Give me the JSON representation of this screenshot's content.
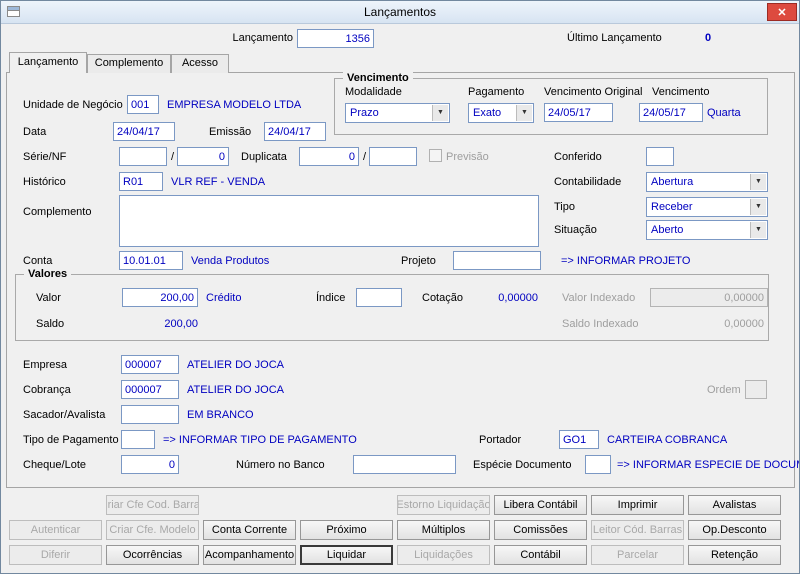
{
  "window": {
    "title": "Lançamentos",
    "close_glyph": "✕"
  },
  "header": {
    "lancamento_label": "Lançamento",
    "lancamento_value": "1356",
    "ultimo_label": "Último Lançamento",
    "ultimo_value": "0"
  },
  "tabs": {
    "t1": "Lançamento",
    "t2": "Complemento",
    "t3": "Acesso"
  },
  "main": {
    "unidade": {
      "label": "Unidade de Negócio",
      "value": "001",
      "desc": "EMPRESA MODELO LTDA"
    },
    "data": {
      "label": "Data",
      "value": "24/04/17"
    },
    "emissao": {
      "label": "Emissão",
      "value": "24/04/17"
    },
    "serie": {
      "label": "Série/NF",
      "v1": "",
      "sep": "/",
      "v2": "0"
    },
    "duplicata": {
      "label": "Duplicata",
      "v1": "0",
      "sep": "/",
      "v2": ""
    },
    "previsao": {
      "label": "Previsão"
    },
    "conferido": {
      "label": "Conferido",
      "value": ""
    },
    "historico": {
      "label": "Histórico",
      "value": "R01",
      "desc": "VLR REF - VENDA"
    },
    "contabilidade": {
      "label": "Contabilidade",
      "value": "Abertura"
    },
    "complemento": {
      "label": "Complemento",
      "value": ""
    },
    "tipo": {
      "label": "Tipo",
      "value": "Receber"
    },
    "situacao": {
      "label": "Situação",
      "value": "Aberto"
    },
    "conta": {
      "label": "Conta",
      "value": "10.01.01",
      "desc": "Venda Produtos"
    },
    "projeto": {
      "label": "Projeto",
      "value": "",
      "desc": "=> INFORMAR PROJETO"
    },
    "empresa": {
      "label": "Empresa",
      "value": "000007",
      "desc": "ATELIER DO JOCA"
    },
    "cobranca": {
      "label": "Cobrança",
      "value": "000007",
      "desc": "ATELIER DO JOCA"
    },
    "ordem": {
      "label": "Ordem",
      "value": ""
    },
    "sacador": {
      "label": "Sacador/Avalista",
      "value": "",
      "desc": "EM BRANCO"
    },
    "tipo_pagamento": {
      "label": "Tipo de Pagamento",
      "value": "",
      "desc": "=> INFORMAR TIPO DE PAGAMENTO"
    },
    "portador": {
      "label": "Portador",
      "value": "GO1",
      "desc": "CARTEIRA COBRANCA"
    },
    "cheque_lote": {
      "label": "Cheque/Lote",
      "value": "0"
    },
    "numero_banco": {
      "label": "Número no Banco",
      "value": ""
    },
    "especie": {
      "label": "Espécie Documento",
      "value": "",
      "desc": "=> INFORMAR ESPECIE DE DOCUM"
    }
  },
  "vencimento": {
    "title": "Vencimento",
    "modalidade_label": "Modalidade",
    "modalidade_value": "Prazo",
    "pagamento_label": "Pagamento",
    "pagamento_value": "Exato",
    "original_label": "Vencimento Original",
    "original_value": "24/05/17",
    "vencimento_label": "Vencimento",
    "vencimento_value": "24/05/17",
    "weekday": "Quarta"
  },
  "valores": {
    "title": "Valores",
    "valor_label": "Valor",
    "valor_value": "200,00",
    "valor_desc": "Crédito",
    "indice_label": "Índice",
    "indice_value": "",
    "cotacao_label": "Cotação",
    "cotacao_value": "0,00000",
    "valor_indexado_label": "Valor Indexado",
    "valor_indexado_value": "0,00000",
    "saldo_label": "Saldo",
    "saldo_value": "200,00",
    "saldo_indexado_label": "Saldo Indexado",
    "saldo_indexado_value": "0,00000"
  },
  "buttons": {
    "row1": [
      {
        "label": "Criar Cfe Cod. Barras",
        "enabled": false
      },
      {
        "label": "Estorno Liquidação",
        "enabled": false
      },
      {
        "label": "Libera Contábil",
        "enabled": true
      },
      {
        "label": "Imprimir",
        "enabled": true
      },
      {
        "label": "Avalistas",
        "enabled": true
      }
    ],
    "row2": [
      {
        "label": "Autenticar",
        "enabled": false
      },
      {
        "label": "Criar Cfe. Modelo",
        "enabled": false
      },
      {
        "label": "Conta Corrente",
        "enabled": true
      },
      {
        "label": "Próximo",
        "enabled": true
      },
      {
        "label": "Múltiplos",
        "enabled": true
      },
      {
        "label": "Comissões",
        "enabled": true
      },
      {
        "label": "Leitor Cód. Barras",
        "enabled": false
      },
      {
        "label": "Op.Desconto",
        "enabled": true
      }
    ],
    "row3": [
      {
        "label": "Diferir",
        "enabled": false
      },
      {
        "label": "Ocorrências",
        "enabled": true
      },
      {
        "label": "Acompanhamento",
        "enabled": true
      },
      {
        "label": "Liquidar",
        "enabled": true,
        "focused": true
      },
      {
        "label": "Liquidações",
        "enabled": false
      },
      {
        "label": "Contábil",
        "enabled": true
      },
      {
        "label": "Parcelar",
        "enabled": false
      },
      {
        "label": "Retenção",
        "enabled": true
      }
    ]
  },
  "colors": {
    "value_text": "#0000c0",
    "disabled_text": "#9e9e9e",
    "input_border": "#7b98c4",
    "close_button": "#dd4a3f",
    "titlebar": "#dfeaf6"
  }
}
